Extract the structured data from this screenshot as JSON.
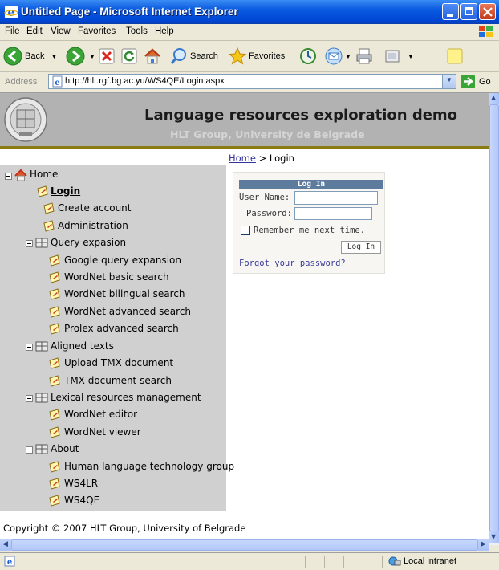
{
  "window": {
    "title": "Untitled Page - Microsoft Internet Explorer"
  },
  "menu": [
    "File",
    "Edit",
    "View",
    "Favorites",
    "Tools",
    "Help"
  ],
  "toolbar": {
    "back_label": "Back",
    "search_label": "Search",
    "favorites_label": "Favorites"
  },
  "address": {
    "label": "Address",
    "url": "http://hlt.rgf.bg.ac.yu/WS4QE/Login.aspx",
    "go_label": "Go"
  },
  "header": {
    "title": "Language resources exploration demo",
    "subtitle": "HLT Group, University de Belgrade"
  },
  "breadcrumb": {
    "home": "Home",
    "separator": " > ",
    "current": "Login"
  },
  "nav": {
    "home": "Home",
    "login": "Login",
    "create_account": "Create account",
    "administration": "Administration",
    "query_expansion": "Query expasion",
    "google_query_expansion": "Google query expansion",
    "wordnet_basic_search": "WordNet basic search",
    "wordnet_bilingual_search": "WordNet bilingual search",
    "wordnet_advanced_search": "WordNet advanced search",
    "prolex_advanced_search": "Prolex advanced search",
    "aligned_texts": "Aligned texts",
    "upload_tmx": "Upload TMX document",
    "tmx_search": "TMX document search",
    "lexical_management": "Lexical resources management",
    "wordnet_editor": "WordNet editor",
    "wordnet_viewer": "WordNet viewer",
    "about": "About",
    "hlt_group": "Human language technology group",
    "ws4lr": "WS4LR",
    "ws4qe": "WS4QE"
  },
  "login": {
    "heading": "Log In",
    "username_label": "User Name:",
    "username_value": "",
    "password_label": "Password:",
    "password_value": "",
    "remember_label": "Remember me next time.",
    "remember_checked": false,
    "button_label": "Log In",
    "forgot_link": "Forgot your password?"
  },
  "footer": {
    "copyright": "Copyright © 2007 HLT Group, University of Belgrade"
  },
  "status": {
    "zone": "Local intranet"
  },
  "colors": {
    "titlebar": "#0a5ae0",
    "header_bg": "#b2b2b2",
    "gold_rule": "#8a7a12",
    "sidebar_bg": "#d0d0d0",
    "login_header": "#5d7b9d",
    "link": "#333399"
  }
}
